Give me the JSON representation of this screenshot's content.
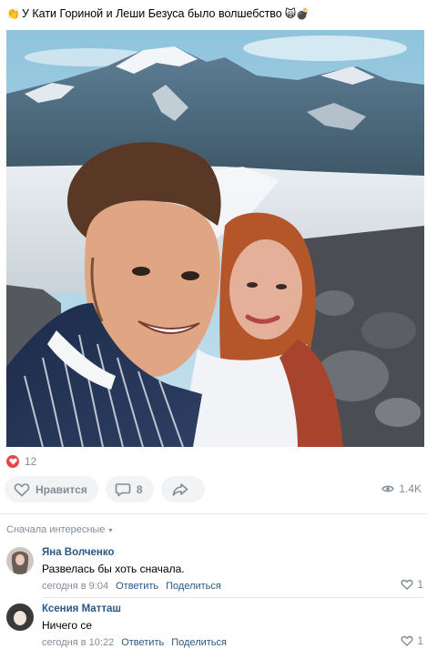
{
  "post": {
    "text": "У Кати Гориной и Леши Безуса было волшебство",
    "emoji_lead": "👏",
    "emoji_tail": "🙀💣"
  },
  "reactions": {
    "likes_count": "12"
  },
  "actions": {
    "like_label": "Нравится",
    "comments_count": "8",
    "views": "1.4K"
  },
  "comments_sort": {
    "label": "Сначала интересные"
  },
  "comments": [
    {
      "author": "Яна Волченко",
      "text": "Развелась бы хоть сначала.",
      "time": "сегодня в 9:04",
      "reply_label": "Ответить",
      "share_label": "Поделиться",
      "likes": "1"
    },
    {
      "author": "Ксения Матташ",
      "text": "Ничего се",
      "time": "сегодня в 10:22",
      "reply_label": "Ответить",
      "share_label": "Поделиться",
      "likes": "1"
    }
  ],
  "colors": {
    "accent_link": "#2a5885",
    "secondary_text": "#818c99",
    "like_red": "#e64646",
    "pill_bg": "#f2f3f5"
  }
}
